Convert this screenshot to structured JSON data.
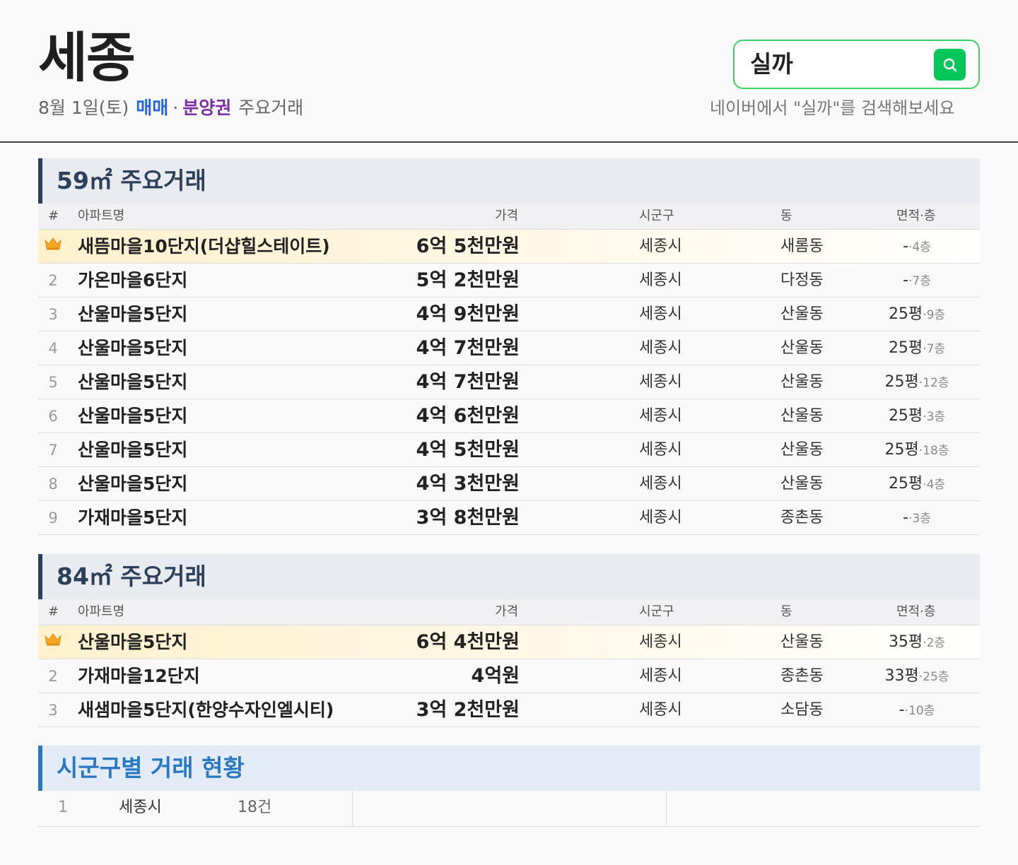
{
  "header": {
    "title": "세종",
    "date": "8월 1일(토)",
    "sale_label": "매매",
    "separator": "·",
    "presale_label": "분양권",
    "major_label": "주요거래",
    "search_text": "실까",
    "search_hint": "네이버에서 \"실까\"를 검색해보세요"
  },
  "columns": {
    "rank": "#",
    "name": "아파트명",
    "price": "가격",
    "city": "시군구",
    "dong": "동",
    "area": "면적·층"
  },
  "sections": [
    {
      "title": "59㎡ 주요거래",
      "rows": [
        {
          "rank": "",
          "name": "새뜸마을10단지(더샵힐스테이트)",
          "price": "6억 5천만원",
          "city": "세종시",
          "dong": "새롬동",
          "area": "-",
          "floor": "·4층"
        },
        {
          "rank": "2",
          "name": "가온마을6단지",
          "price": "5억 2천만원",
          "city": "세종시",
          "dong": "다정동",
          "area": "-",
          "floor": "·7층"
        },
        {
          "rank": "3",
          "name": "산울마을5단지",
          "price": "4억 9천만원",
          "city": "세종시",
          "dong": "산울동",
          "area": "25평",
          "floor": "·9층"
        },
        {
          "rank": "4",
          "name": "산울마을5단지",
          "price": "4억 7천만원",
          "city": "세종시",
          "dong": "산울동",
          "area": "25평",
          "floor": "·7층"
        },
        {
          "rank": "5",
          "name": "산울마을5단지",
          "price": "4억 7천만원",
          "city": "세종시",
          "dong": "산울동",
          "area": "25평",
          "floor": "·12층"
        },
        {
          "rank": "6",
          "name": "산울마을5단지",
          "price": "4억 6천만원",
          "city": "세종시",
          "dong": "산울동",
          "area": "25평",
          "floor": "·3층"
        },
        {
          "rank": "7",
          "name": "산울마을5단지",
          "price": "4억 5천만원",
          "city": "세종시",
          "dong": "산울동",
          "area": "25평",
          "floor": "·18층"
        },
        {
          "rank": "8",
          "name": "산울마을5단지",
          "price": "4억 3천만원",
          "city": "세종시",
          "dong": "산울동",
          "area": "25평",
          "floor": "·4층"
        },
        {
          "rank": "9",
          "name": "가재마을5단지",
          "price": "3억 8천만원",
          "city": "세종시",
          "dong": "종촌동",
          "area": "-",
          "floor": "·3층"
        }
      ]
    },
    {
      "title": "84㎡ 주요거래",
      "rows": [
        {
          "rank": "",
          "name": "산울마을5단지",
          "price": "6억 4천만원",
          "city": "세종시",
          "dong": "산울동",
          "area": "35평",
          "floor": "·2층"
        },
        {
          "rank": "2",
          "name": "가재마을12단지",
          "price": "4억원",
          "city": "세종시",
          "dong": "종촌동",
          "area": "33평",
          "floor": "·25층"
        },
        {
          "rank": "3",
          "name": "새샘마을5단지(한양수자인엘시티)",
          "price": "3억 2천만원",
          "city": "세종시",
          "dong": "소담동",
          "area": "-",
          "floor": "·10층"
        }
      ]
    }
  ],
  "district_stats": {
    "title": "시군구별 거래 현황",
    "rows": [
      {
        "rank": "1",
        "name": "세종시",
        "count": "18건"
      }
    ]
  },
  "colors": {
    "accent_green": "#03c75a",
    "sale_blue": "#2563eb",
    "presale_purple": "#7b2fa3",
    "section_navy": "#2e3f59",
    "stat_blue": "#2b78c2"
  }
}
